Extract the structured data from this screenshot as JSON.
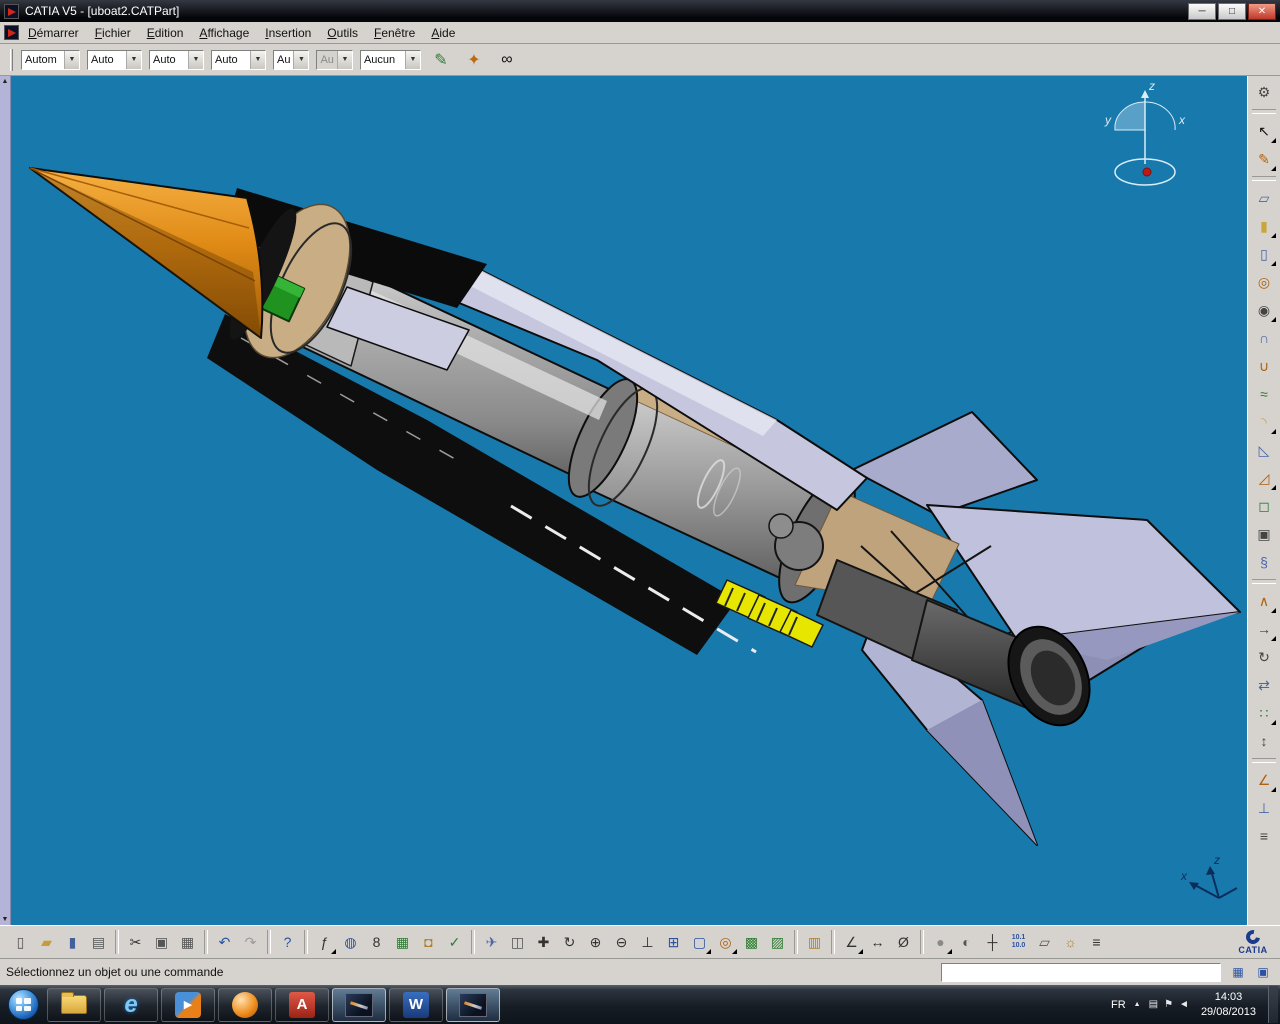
{
  "window": {
    "title": "CATIA V5 - [uboat2.CATPart]",
    "controls": [
      {
        "name": "minimize-button",
        "glyph": "─"
      },
      {
        "name": "maximize-button",
        "glyph": "□"
      },
      {
        "name": "close-button",
        "glyph": "✕"
      }
    ]
  },
  "menubar": {
    "items": [
      {
        "label": "Démarrer"
      },
      {
        "label": "Fichier"
      },
      {
        "label": "Edition"
      },
      {
        "label": "Affichage"
      },
      {
        "label": "Insertion"
      },
      {
        "label": "Outils"
      },
      {
        "label": "Fenêtre"
      },
      {
        "label": "Aide"
      }
    ]
  },
  "toolbar": {
    "combos": [
      {
        "value": "Autom"
      },
      {
        "value": "Auto"
      },
      {
        "value": "Auto"
      },
      {
        "value": "Auto"
      },
      {
        "value": "Au"
      },
      {
        "value": "Au",
        "disabled": true
      },
      {
        "value": "Aucun"
      }
    ],
    "buttons": [
      {
        "name": "painter-icon",
        "glyph": "✎",
        "color": "#2e7d32"
      },
      {
        "name": "paint-wizard-icon",
        "glyph": "✦",
        "color": "#c06a10"
      },
      {
        "name": "custom-view-icon",
        "glyph": "∞",
        "color": "#111111"
      }
    ]
  },
  "tree_scrollbar": {
    "up": "▲",
    "down": "▼"
  },
  "viewport": {
    "background": "#1879ac",
    "compass": {
      "x": "x",
      "y": "y",
      "z": "z"
    },
    "triad": {
      "x": "x",
      "z": "z"
    }
  },
  "right_toolbar": {
    "items": [
      {
        "name": "settings-gear-icon",
        "glyph": "⚙",
        "color": "#444444"
      },
      {
        "sep": true
      },
      {
        "name": "select-icon",
        "glyph": "↖",
        "color": "#111111",
        "fly": true
      },
      {
        "name": "sketcher-icon",
        "glyph": "✎",
        "color": "#b06010",
        "fly": true
      },
      {
        "sep": true
      },
      {
        "name": "plane-icon",
        "glyph": "▱",
        "color": "#4a66aa"
      },
      {
        "name": "pad-icon",
        "glyph": "▮",
        "color": "#caa53c",
        "fly": true
      },
      {
        "name": "pocket-icon",
        "glyph": "▯",
        "color": "#4a66aa",
        "fly": true
      },
      {
        "name": "shaft-icon",
        "glyph": "◎",
        "color": "#b06010"
      },
      {
        "name": "hole-icon",
        "glyph": "◉",
        "color": "#444444",
        "fly": true
      },
      {
        "name": "rib-icon",
        "glyph": "∩",
        "color": "#4a66aa"
      },
      {
        "name": "slot-icon",
        "glyph": "∪",
        "color": "#b06010"
      },
      {
        "name": "loft-icon",
        "glyph": "≈",
        "color": "#2e7d32"
      },
      {
        "name": "fillet-icon",
        "glyph": "◝",
        "color": "#caa53c",
        "fly": true
      },
      {
        "name": "chamfer-icon",
        "glyph": "◺",
        "color": "#4a66aa"
      },
      {
        "name": "draft-icon",
        "glyph": "◿",
        "color": "#b06010",
        "fly": true
      },
      {
        "name": "shell-icon",
        "glyph": "◻",
        "color": "#2e7d32"
      },
      {
        "name": "thickness-icon",
        "glyph": "▣",
        "color": "#444444"
      },
      {
        "name": "thread-icon",
        "glyph": "§",
        "color": "#4a66aa"
      },
      {
        "sep": true
      },
      {
        "name": "boolean-icon",
        "glyph": "∧",
        "color": "#b06010",
        "fly": true
      },
      {
        "name": "translate-icon",
        "glyph": "→",
        "color": "#444444",
        "fly": true
      },
      {
        "name": "rotate-icon",
        "glyph": "↻",
        "color": "#444444"
      },
      {
        "name": "mirror-icon",
        "glyph": "⇄",
        "color": "#4a66aa"
      },
      {
        "name": "pattern-icon",
        "glyph": "∷",
        "color": "#2e7d32",
        "fly": true
      },
      {
        "name": "scale-icon",
        "glyph": "↕",
        "color": "#444444"
      },
      {
        "sep": true
      },
      {
        "name": "measure-tool-icon",
        "glyph": "∠",
        "color": "#b06010",
        "fly": true
      },
      {
        "name": "axis-system-icon",
        "glyph": "⊥",
        "color": "#4a66aa"
      },
      {
        "name": "catalog-browser-icon",
        "glyph": "≡",
        "color": "#444444"
      }
    ]
  },
  "bottom_toolbar": {
    "items": [
      {
        "name": "new-file-icon",
        "glyph": "▯",
        "color": "#555555"
      },
      {
        "name": "open-icon",
        "glyph": "▰",
        "color": "#c79b3b"
      },
      {
        "name": "save-icon",
        "glyph": "▮",
        "color": "#44609c"
      },
      {
        "name": "print-icon",
        "glyph": "▤",
        "color": "#555555"
      },
      {
        "sep": true
      },
      {
        "name": "cut-icon",
        "glyph": "✂",
        "color": "#333333"
      },
      {
        "name": "copy-icon",
        "glyph": "▣",
        "color": "#555555"
      },
      {
        "name": "paste-icon",
        "glyph": "▦",
        "color": "#555555"
      },
      {
        "sep": true
      },
      {
        "name": "undo-icon",
        "glyph": "↶",
        "color": "#2a52a0"
      },
      {
        "name": "redo-icon",
        "glyph": "↷",
        "color": "#9a9a9a"
      },
      {
        "sep": true
      },
      {
        "name": "whats-this-icon",
        "glyph": "?",
        "color": "#2a52a0"
      },
      {
        "sep": true
      },
      {
        "name": "formula-icon",
        "glyph": "ƒ",
        "color": "#333333",
        "fly": true
      },
      {
        "name": "comment-icon",
        "glyph": "◍",
        "color": "#2a52a0"
      },
      {
        "name": "knowledge-icon",
        "glyph": "8",
        "color": "#333333"
      },
      {
        "name": "design-table-icon",
        "glyph": "▦",
        "color": "#2e7d32"
      },
      {
        "name": "lock-icon",
        "glyph": "◘",
        "color": "#b08030"
      },
      {
        "name": "check-analysis-icon",
        "glyph": "✓",
        "color": "#2e7d32"
      },
      {
        "sep": true
      },
      {
        "name": "fly-mode-icon",
        "glyph": "✈",
        "color": "#4a66aa"
      },
      {
        "name": "split-view-icon",
        "glyph": "◫",
        "color": "#555555"
      },
      {
        "name": "pan-icon",
        "glyph": "✚",
        "color": "#333333"
      },
      {
        "name": "rotate-view-icon",
        "glyph": "↻",
        "color": "#333333"
      },
      {
        "name": "zoom-in-icon",
        "glyph": "⊕",
        "color": "#333333"
      },
      {
        "name": "zoom-out-icon",
        "glyph": "⊖",
        "color": "#333333"
      },
      {
        "name": "normal-view-icon",
        "glyph": "⊥",
        "color": "#333333"
      },
      {
        "name": "multi-view-icon",
        "glyph": "⊞",
        "color": "#2a52a0"
      },
      {
        "name": "quick-view-icon",
        "glyph": "▢",
        "color": "#2a52a0",
        "fly": true
      },
      {
        "name": "render-style-icon",
        "glyph": "◎",
        "color": "#b06010",
        "fly": true
      },
      {
        "name": "hide-show-icon",
        "glyph": "▩",
        "color": "#2e7d32"
      },
      {
        "name": "swap-space-icon",
        "glyph": "▨",
        "color": "#2e7d32"
      },
      {
        "sep": true
      },
      {
        "name": "catalog-icon",
        "glyph": "▥",
        "color": "#b08030"
      },
      {
        "sep": true
      },
      {
        "name": "measure-icon",
        "glyph": "∠",
        "color": "#333333",
        "fly": true
      },
      {
        "name": "measure-between-icon",
        "glyph": "↔",
        "color": "#333333"
      },
      {
        "name": "inertia-icon",
        "glyph": "Ø",
        "color": "#333333"
      },
      {
        "sep": true
      },
      {
        "name": "shading-icon",
        "glyph": "●",
        "color": "#8a8a8a",
        "fly": true
      },
      {
        "name": "grab-icon",
        "glyph": "◐",
        "color": "#555555"
      },
      {
        "name": "axis-display-icon",
        "glyph": "┼",
        "color": "#333333"
      },
      {
        "name": "scale-indicator-icon",
        "lines": [
          "10.1",
          "10.0"
        ]
      },
      {
        "name": "depth-effect-icon",
        "glyph": "▱",
        "color": "#555555"
      },
      {
        "name": "lighting-icon",
        "glyph": "☼",
        "color": "#b08030"
      },
      {
        "name": "list-icon",
        "glyph": "≡",
        "color": "#333333"
      }
    ],
    "logo": {
      "product": "CATIA"
    }
  },
  "statusbar": {
    "message": "Sélectionnez un objet ou une commande",
    "field_value": "",
    "buttons": [
      {
        "name": "power-input-icon",
        "glyph": "▦"
      },
      {
        "name": "doc-link-icon",
        "glyph": "▣"
      }
    ]
  },
  "taskbar": {
    "apps": [
      {
        "name": "start-button",
        "kind": "orb"
      },
      {
        "name": "taskbar-explorer",
        "kind": "folder"
      },
      {
        "name": "taskbar-internet-explorer",
        "kind": "ie",
        "label": "e"
      },
      {
        "name": "taskbar-media-player",
        "kind": "wmp",
        "label": "▶"
      },
      {
        "name": "taskbar-app-orange",
        "kind": "ball"
      },
      {
        "name": "taskbar-adobe-reader",
        "kind": "adobe",
        "label": "A"
      },
      {
        "name": "taskbar-catia",
        "kind": "thumb",
        "active": true
      },
      {
        "name": "taskbar-word",
        "kind": "word",
        "label": "W"
      },
      {
        "name": "taskbar-catia-2",
        "kind": "thumb",
        "active": true
      }
    ],
    "tray": {
      "language": "FR",
      "expand": "▲",
      "icons": [
        {
          "name": "tray-display-icon",
          "glyph": "▤"
        },
        {
          "name": "tray-notify-icon",
          "glyph": "⚑"
        },
        {
          "name": "tray-volume-icon",
          "glyph": "◄"
        }
      ],
      "time": "14:03",
      "date": "29/08/2013"
    }
  }
}
